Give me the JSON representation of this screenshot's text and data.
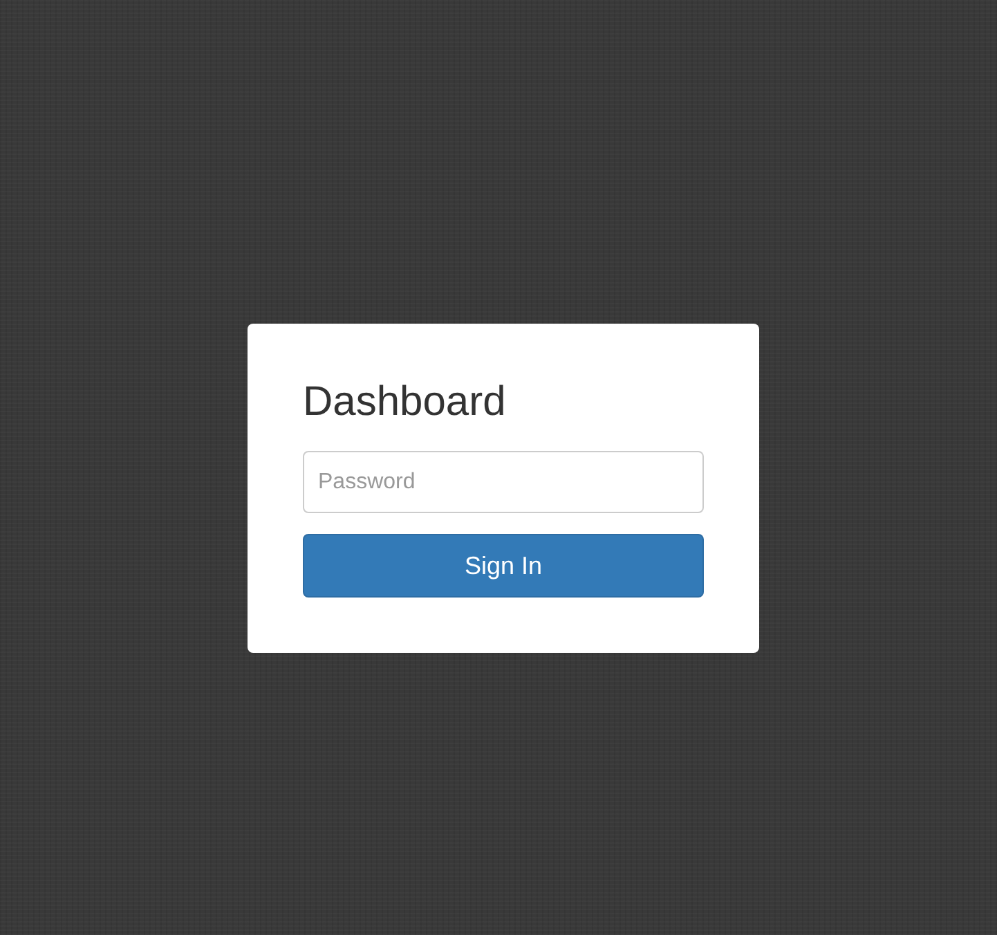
{
  "login": {
    "title": "Dashboard",
    "password": {
      "placeholder": "Password"
    },
    "button": "Sign In"
  }
}
